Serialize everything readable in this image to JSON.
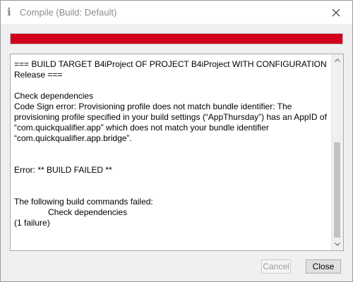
{
  "window": {
    "title_icon": "i",
    "title": "Compile (Build: Default)",
    "close_icon": "close-icon"
  },
  "progress": {
    "fill_fraction": 1.0,
    "color": "#d3001b"
  },
  "log": {
    "lines": [
      "=== BUILD TARGET B4iProject OF PROJECT B4iProject WITH CONFIGURATION",
      "Release ===",
      "",
      "Check dependencies",
      "Code Sign error: Provisioning profile does not match bundle identifier: The",
      "provisioning profile specified in your build settings (“AppThursday”) has an AppID of",
      "“com.quickqualifier.app” which does not match your bundle identifier",
      "“com.quickqualifier.app.bridge”.",
      "",
      "",
      "Error: ** BUILD FAILED **",
      "",
      "",
      "The following build commands failed:",
      "\t\tCheck dependencies",
      "(1 failure)"
    ]
  },
  "buttons": {
    "cancel_label": "Cancel",
    "close_label": "Close"
  }
}
